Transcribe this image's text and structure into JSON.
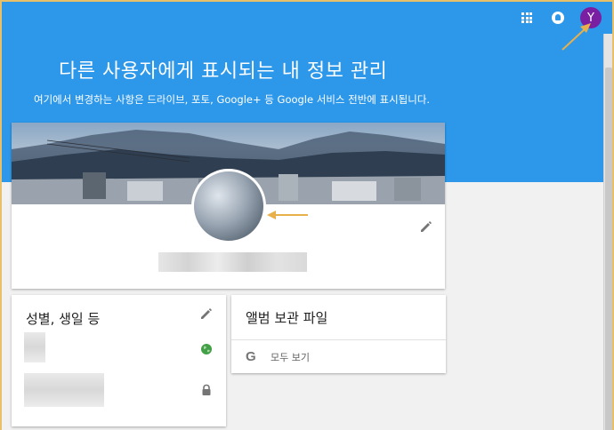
{
  "header": {
    "title": "다른 사용자에게 표시되는 내 정보 관리",
    "subtitle": "여기에서 변경하는 사항은 드라이브, 포토, Google+ 등 Google 서비스 전반에 표시됩니다.",
    "avatar_initial": "Y",
    "icons": [
      "apps-grid-icon",
      "notifications-bell-icon"
    ]
  },
  "profile_card": {
    "edit_icon": "pencil-icon"
  },
  "info_card": {
    "title": "성별, 생일 등",
    "icons": [
      "pencil-icon",
      "globe-public-icon",
      "lock-private-icon"
    ]
  },
  "album_card": {
    "title": "앨범 보관 파일",
    "view_all_label": "모두 보기",
    "view_all_icon": "google-g-icon",
    "google_glyph": "G"
  },
  "colors": {
    "hero_blue": "#2d97ea",
    "avatar_purple": "#7b1fa2",
    "globe_green": "#43a047",
    "icon_gray": "#757575",
    "annotation_arrow": "#e8b04a"
  }
}
